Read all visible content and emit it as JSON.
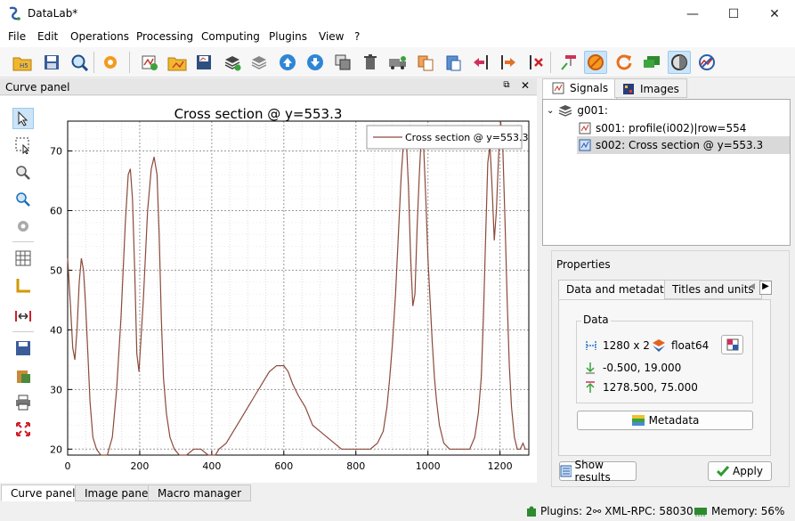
{
  "window": {
    "title": "DataLab*",
    "minimize": "—",
    "maximize": "☐",
    "close": "✕"
  },
  "menu": [
    "File",
    "Edit",
    "Operations",
    "Processing",
    "Computing",
    "Plugins",
    "View",
    "?"
  ],
  "curve_panel": {
    "title": "Curve panel"
  },
  "bottom_tabs": [
    "Curve panel",
    "Image panel",
    "Macro manager"
  ],
  "right_tabs": {
    "signals": "Signals",
    "images": "Images"
  },
  "tree": {
    "group": "g001:",
    "items": [
      "s001: profile(i002)|row=554",
      "s002: Cross section @ y=553.3"
    ]
  },
  "properties": {
    "title": "Properties",
    "tabs": [
      "Data and metadata",
      "Titles and units",
      "◀",
      "▶"
    ],
    "data_group": "Data",
    "shape": "1280 x 2",
    "dtype": "float64",
    "xrange": "-0.500, 19.000",
    "yrange": "1278.500, 75.000",
    "metadata_button": "Metadata",
    "show_results_button": "Show results",
    "apply_button": "Apply"
  },
  "status": {
    "plugins": "Plugins: 2",
    "xmlrpc": "XML-RPC: 58030",
    "memory": "Memory: 56%"
  },
  "chart_data": {
    "type": "line",
    "title": "Cross section @ y=553.3",
    "legend_position": "top-right",
    "xlim": [
      0,
      1280
    ],
    "ylim": [
      19,
      75
    ],
    "xticks": [
      0,
      200,
      400,
      600,
      800,
      1000,
      1200
    ],
    "yticks": [
      20,
      30,
      40,
      50,
      60,
      70
    ],
    "grid": true,
    "series": [
      {
        "name": "Cross section @ y=553.3",
        "color": "#8b4a3c",
        "x": [
          0,
          8,
          14,
          20,
          26,
          32,
          38,
          44,
          50,
          56,
          62,
          70,
          80,
          92,
          100,
          110,
          124,
          136,
          148,
          160,
          168,
          174,
          180,
          186,
          192,
          198,
          210,
          222,
          232,
          240,
          248,
          254,
          260,
          266,
          274,
          284,
          296,
          310,
          330,
          350,
          370,
          390,
          400,
          410,
          420,
          440,
          460,
          480,
          500,
          520,
          540,
          560,
          580,
          592,
          600,
          612,
          624,
          640,
          660,
          680,
          700,
          720,
          740,
          760,
          780,
          800,
          820,
          840,
          860,
          876,
          886,
          894,
          902,
          910,
          918,
          926,
          934,
          940,
          946,
          952,
          958,
          964,
          970,
          976,
          982,
          988,
          994,
          1000,
          1006,
          1012,
          1018,
          1024,
          1032,
          1044,
          1060,
          1080,
          1100,
          1116,
          1130,
          1140,
          1148,
          1154,
          1160,
          1166,
          1172,
          1178,
          1184,
          1190,
          1196,
          1202,
          1208,
          1214,
          1220,
          1226,
          1232,
          1240,
          1248,
          1256,
          1264,
          1270,
          1276
        ],
        "y": [
          52,
          44,
          37,
          35,
          40,
          48,
          52,
          50,
          44,
          36,
          28,
          22,
          20,
          19,
          19,
          19,
          22,
          30,
          42,
          58,
          66,
          67,
          62,
          50,
          36,
          33,
          45,
          60,
          67,
          69,
          66,
          56,
          42,
          32,
          26,
          22,
          20,
          19,
          19,
          20,
          20,
          19,
          19,
          19,
          20,
          21,
          23,
          25,
          27,
          29,
          31,
          33,
          34,
          34,
          34,
          33,
          31,
          29,
          27,
          24,
          23,
          22,
          21,
          20,
          20,
          20,
          20,
          20,
          21,
          23,
          27,
          32,
          38,
          46,
          56,
          66,
          73,
          72,
          64,
          52,
          44,
          46,
          57,
          66,
          73,
          71,
          62,
          52,
          45,
          38,
          32,
          28,
          24,
          21,
          20,
          20,
          20,
          20,
          22,
          26,
          32,
          42,
          55,
          68,
          71,
          64,
          55,
          60,
          69,
          75,
          70,
          58,
          45,
          34,
          27,
          22,
          20,
          20,
          21,
          20,
          20
        ]
      }
    ]
  }
}
